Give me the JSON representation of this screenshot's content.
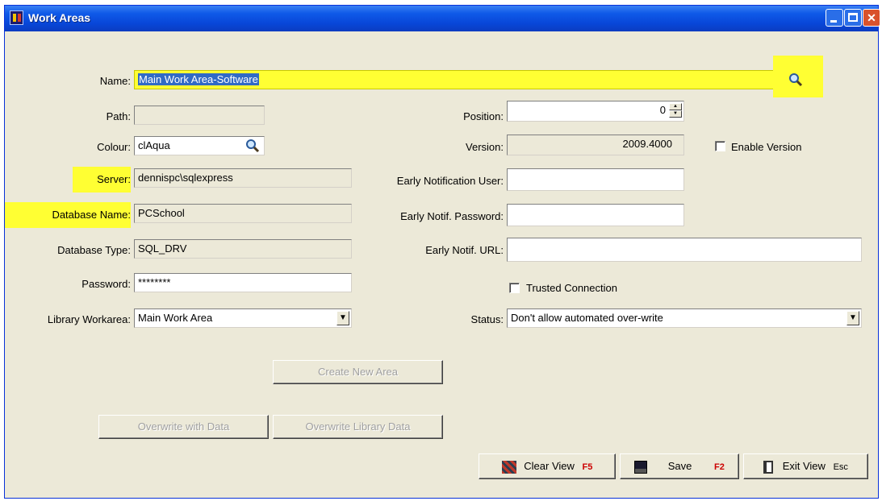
{
  "window": {
    "title": "Work Areas"
  },
  "form": {
    "name_label": "Name:",
    "name_value": "Main Work Area-Software",
    "path_label": "Path:",
    "path_value": "",
    "colour_label": "Colour:",
    "colour_value": "clAqua",
    "server_label": "Server:",
    "server_value": "dennispc\\sqlexpress",
    "dbname_label": "Database Name:",
    "dbname_value": "PCSchool",
    "dbtype_label": "Database Type:",
    "dbtype_value": "SQL_DRV",
    "password_label": "Password:",
    "password_value": "********",
    "library_label": "Library Workarea:",
    "library_value": "Main Work Area",
    "position_label": "Position:",
    "position_value": "0",
    "version_label": "Version:",
    "version_value": "2009.4000",
    "enable_version_label": "Enable Version",
    "early_user_label": "Early Notification User:",
    "early_user_value": "",
    "early_pass_label": "Early Notif. Password:",
    "early_pass_value": "",
    "early_url_label": "Early Notif. URL:",
    "early_url_value": "",
    "trusted_label": "Trusted Connection",
    "status_label": "Status:",
    "status_value": "Don't allow automated over-write"
  },
  "buttons": {
    "create_new_area": "Create New Area",
    "overwrite_data": "Overwrite with Data",
    "overwrite_library": "Overwrite Library Data",
    "clear_view": "Clear View",
    "clear_view_key": "F5",
    "save": "Save",
    "save_key": "F2",
    "exit_view": "Exit View",
    "exit_view_key": "Esc"
  },
  "colors": {
    "highlight": "#ffff33",
    "title_bar": "#0846d8",
    "selection": "#316ac5"
  }
}
